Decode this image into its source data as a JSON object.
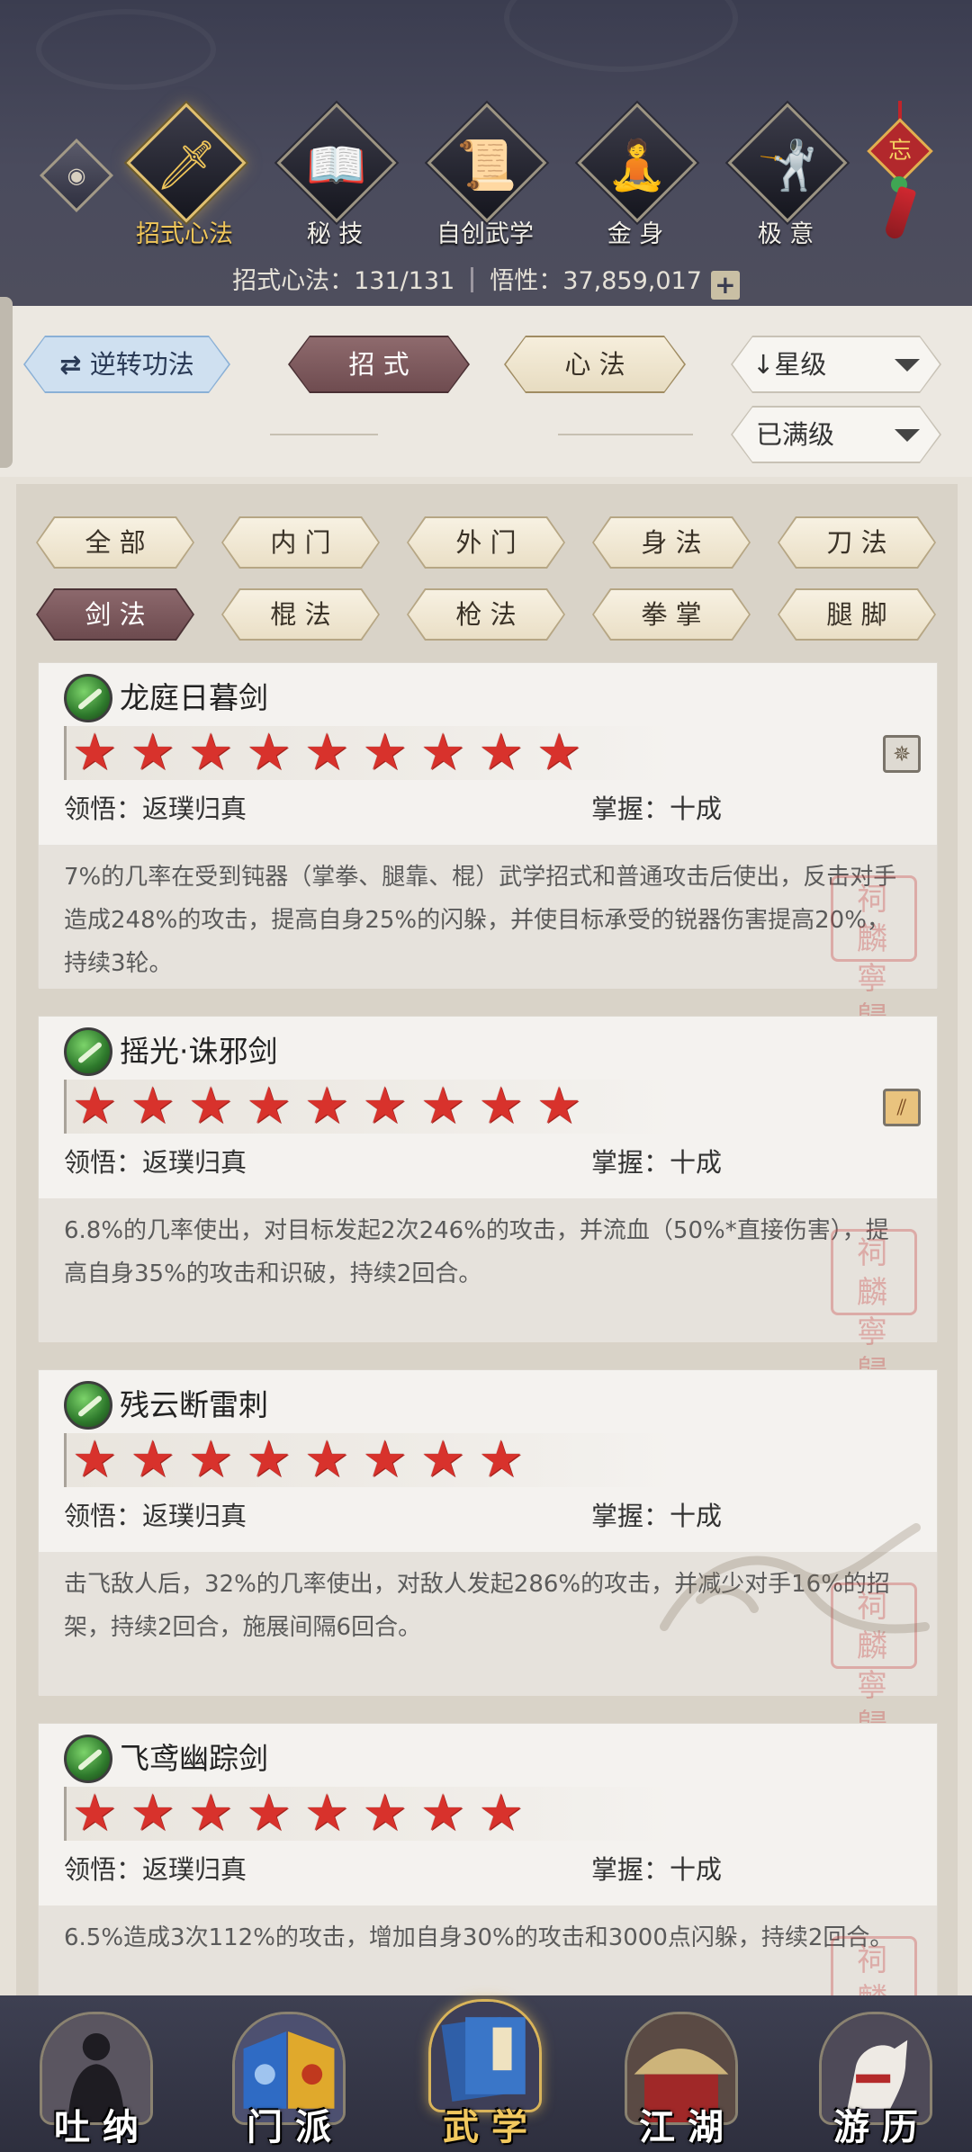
{
  "top_tabs": [
    {
      "label": "招式心法",
      "icon": "sword-icon"
    },
    {
      "label": "秘 技",
      "icon": "book-icon"
    },
    {
      "label": "自创武学",
      "icon": "scroll-icon"
    },
    {
      "label": "金 身",
      "icon": "meditation-icon"
    },
    {
      "label": "极 意",
      "icon": "martial-pose-icon"
    }
  ],
  "knot_char": "忘",
  "stats": {
    "moves_label": "招式心法：131/131",
    "insight_label": "悟性：37,859,017",
    "plus": "+"
  },
  "controls": {
    "reverse_label": "逆转功法",
    "reverse_icon": "⇄",
    "tab_moves": "招 式",
    "tab_heart": "心 法",
    "sort_label": "星级",
    "sort_arrow": "↓",
    "filter_label": "已满级"
  },
  "categories": [
    {
      "label": "全 部",
      "active": false
    },
    {
      "label": "内 门",
      "active": false
    },
    {
      "label": "外 门",
      "active": false
    },
    {
      "label": "身 法",
      "active": false
    },
    {
      "label": "刀 法",
      "active": false
    },
    {
      "label": "剑 法",
      "active": true
    },
    {
      "label": "棍 法",
      "active": false
    },
    {
      "label": "枪 法",
      "active": false
    },
    {
      "label": "拳 掌",
      "active": false
    },
    {
      "label": "腿 脚",
      "active": false
    }
  ],
  "cards": [
    {
      "name": "龙庭日暮剑",
      "stars": 9,
      "comprehension": "领悟：返璞归真",
      "mastery": "掌握：十成",
      "description": "7%的几率在受到钝器（掌拳、腿靠、棍）武学招式和普通攻击后使出，反击对手造成248%的攻击，提高自身25%的闪躲，并使目标承受的锐器伤害提高20%，持续3轮。",
      "corner_icon": "compass-icon"
    },
    {
      "name": "摇光·诛邪剑",
      "stars": 9,
      "comprehension": "领悟：返璞归真",
      "mastery": "掌握：十成",
      "description": "6.8%的几率使出，对目标发起2次246%的攻击，并流血（50%*直接伤害），提高自身35%的攻击和识破，持续2回合。",
      "corner_icon": "slash-icon"
    },
    {
      "name": "残云断雷刺",
      "stars": 8,
      "comprehension": "领悟：返璞归真",
      "mastery": "掌握：十成",
      "description": "击飞敌人后，32%的几率使出，对敌人发起286%的攻击，并减少对手16%的招架，持续2回合，施展间隔6回合。",
      "corner_icon": ""
    },
    {
      "name": "飞鸢幽踪剑",
      "stars": 8,
      "comprehension": "领悟：返璞归真",
      "mastery": "掌握：十成",
      "description": "6.5%造成3次112%的攻击，增加自身30%的攻击和3000点闪躲，持续2回合。",
      "corner_icon": ""
    }
  ],
  "seal_text": "祠 麟 寧 歸",
  "bottom_nav": [
    {
      "label": "吐 纳",
      "icon": "meditating-figure-icon",
      "active": false
    },
    {
      "label": "门 派",
      "icon": "sect-flags-icon",
      "active": false
    },
    {
      "label": "武 学",
      "icon": "martial-books-icon",
      "active": true
    },
    {
      "label": "江 湖",
      "icon": "straw-hat-icon",
      "active": false
    },
    {
      "label": "游 历",
      "icon": "white-horse-icon",
      "active": false
    }
  ],
  "colors": {
    "header_bg": "#3b3d50",
    "accent_gold": "#f0c65a",
    "active_chip": "#6d4b4f",
    "star_red": "#d8322c"
  }
}
